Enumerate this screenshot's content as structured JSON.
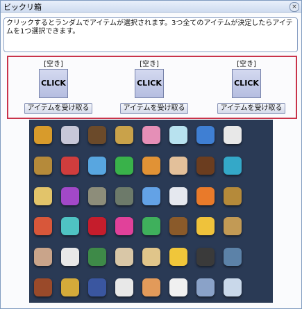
{
  "window": {
    "title": "ビックリ箱",
    "close_glyph": "×"
  },
  "description": "クリックするとランダムでアイテムが選択されます。3つ全てのアイテムが決定したらアイテムを1つ選択できます。",
  "slots": [
    {
      "label": "[空き]",
      "click_label": "CLICK",
      "receive_label": "アイテムを受け取る"
    },
    {
      "label": "[空き]",
      "click_label": "CLICK",
      "receive_label": "アイテムを受け取る"
    },
    {
      "label": "[空き]",
      "click_label": "CLICK",
      "receive_label": "アイテムを受け取る"
    }
  ],
  "items": [
    {
      "icon": "top-icon",
      "color": "#d89b2b"
    },
    {
      "icon": "winged-figure-icon",
      "color": "#c7c7d8"
    },
    {
      "icon": "cauldron-icon",
      "color": "#6b4a2a"
    },
    {
      "icon": "ticket-icon",
      "color": "#c9a24a"
    },
    {
      "icon": "pink-cube-icon",
      "color": "#e58fb7"
    },
    {
      "icon": "egg-icon",
      "color": "#b8e2ef"
    },
    {
      "icon": "blue-box-icon",
      "color": "#3f7fd3"
    },
    {
      "icon": "bowling-pin-icon",
      "color": "#e8e8e8"
    },
    {
      "icon": "spacer",
      "color": "#2a3a55"
    },
    {
      "icon": "scroll-icon",
      "color": "#b58a3a"
    },
    {
      "icon": "red-crystal-icon",
      "color": "#d03d3d"
    },
    {
      "icon": "blue-crystal-icon",
      "color": "#58a6e0"
    },
    {
      "icon": "green-crystal-icon",
      "color": "#39b24a"
    },
    {
      "icon": "orange-crystal-icon",
      "color": "#e19235"
    },
    {
      "icon": "card-icon",
      "color": "#e3c09a"
    },
    {
      "icon": "jar-icon",
      "color": "#6b3d1f"
    },
    {
      "icon": "potion-icon",
      "color": "#34a8c8"
    },
    {
      "icon": "spacer",
      "color": "#2a3a55"
    },
    {
      "icon": "paper-icon",
      "color": "#e2c46a"
    },
    {
      "icon": "purple-crystal-icon",
      "color": "#a248c8"
    },
    {
      "icon": "stone-icon",
      "color": "#8d8d7a"
    },
    {
      "icon": "egg-timer-icon",
      "color": "#6d7a6a"
    },
    {
      "icon": "blue-card-icon",
      "color": "#63a2e6"
    },
    {
      "icon": "wing-icon",
      "color": "#e5e8ef"
    },
    {
      "icon": "orange-potion-icon",
      "color": "#e97a2a"
    },
    {
      "icon": "orb-icon",
      "color": "#b58a3a"
    },
    {
      "icon": "spacer",
      "color": "#2a3a55"
    },
    {
      "icon": "flower-icon",
      "color": "#d8573a"
    },
    {
      "icon": "aqua-flower-icon",
      "color": "#4fc3c3"
    },
    {
      "icon": "ruby-icon",
      "color": "#c51d2c"
    },
    {
      "icon": "pink-potion-icon",
      "color": "#e1419a"
    },
    {
      "icon": "green-potion-icon",
      "color": "#3fb05c"
    },
    {
      "icon": "bag-icon",
      "color": "#8a5a2a"
    },
    {
      "icon": "capsule-icon",
      "color": "#efc23b"
    },
    {
      "icon": "scroll-bundle-icon",
      "color": "#c29a55"
    },
    {
      "icon": "spacer",
      "color": "#2a3a55"
    },
    {
      "icon": "basket-icon",
      "color": "#c9a48a"
    },
    {
      "icon": "pill-icon",
      "color": "#e8e8e8"
    },
    {
      "icon": "chest-icon",
      "color": "#3e8a48"
    },
    {
      "icon": "card-wing-icon",
      "color": "#d9c7a7"
    },
    {
      "icon": "book-icon",
      "color": "#e0c58a"
    },
    {
      "icon": "yellow-capsule-icon",
      "color": "#f0c63a"
    },
    {
      "icon": "dark-box-icon",
      "color": "#3a3a3a"
    },
    {
      "icon": "coin-icon",
      "color": "#5c82a8"
    },
    {
      "icon": "spacer",
      "color": "#2a3a55"
    },
    {
      "icon": "bronze-coin-icon",
      "color": "#9a4a2a"
    },
    {
      "icon": "gold-medal-icon",
      "color": "#d4aa3a"
    },
    {
      "icon": "navy-badge-icon",
      "color": "#3a56a0"
    },
    {
      "icon": "bell-icon",
      "color": "#e8e8e8"
    },
    {
      "icon": "ring-icon",
      "color": "#e29a5a"
    },
    {
      "icon": "dice-icon",
      "color": "#f0f0f0"
    },
    {
      "icon": "diamond-plate-icon",
      "color": "#8aa2c8"
    },
    {
      "icon": "stars-icon",
      "color": "#c9d8ea"
    },
    {
      "icon": "spacer",
      "color": "#2a3a55"
    }
  ]
}
